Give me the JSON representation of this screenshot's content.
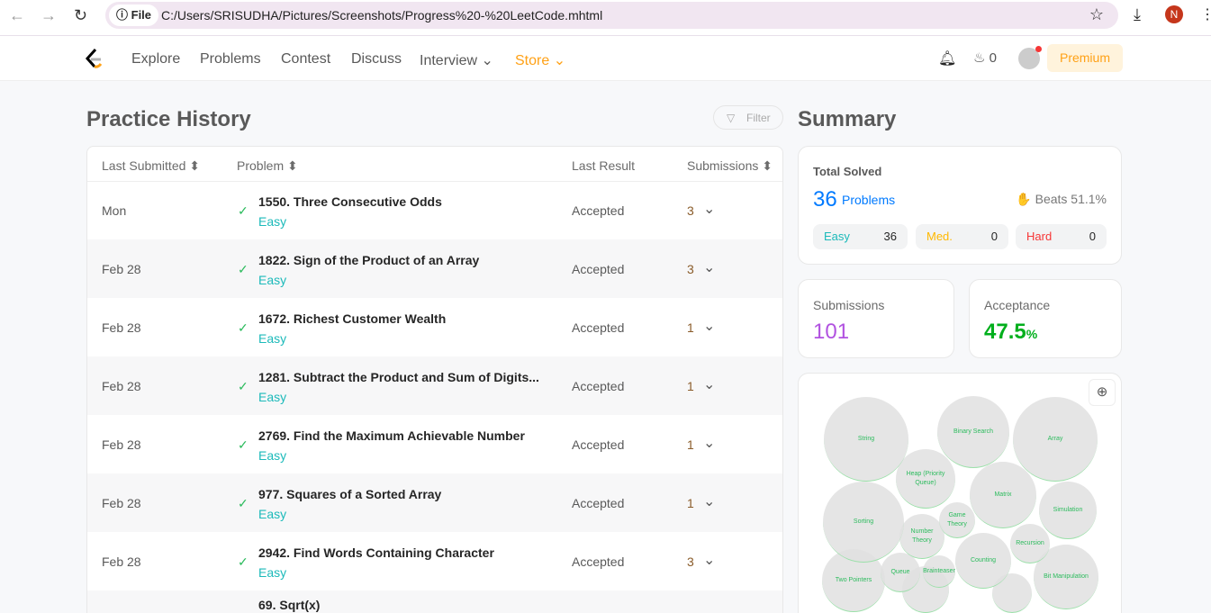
{
  "browser": {
    "file_label": "File",
    "url": "C:/Users/SRISUDHA/Pictures/Screenshots/Progress%20-%20LeetCode.mhtml",
    "avatar": "N"
  },
  "nav": {
    "items": [
      "Explore",
      "Problems",
      "Contest",
      "Discuss",
      "Interview"
    ],
    "store": "Store",
    "streak": "0",
    "premium": "Premium"
  },
  "history": {
    "title": "Practice History",
    "filter": "Filter",
    "columns": [
      "Last Submitted",
      "Problem",
      "Last Result",
      "Submissions"
    ],
    "rows": [
      {
        "date": "Mon",
        "title": "1550. Three Consecutive Odds",
        "difficulty": "Easy",
        "result": "Accepted",
        "subs": "3"
      },
      {
        "date": "Feb 28",
        "title": "1822. Sign of the Product of an Array",
        "difficulty": "Easy",
        "result": "Accepted",
        "subs": "3"
      },
      {
        "date": "Feb 28",
        "title": "1672. Richest Customer Wealth",
        "difficulty": "Easy",
        "result": "Accepted",
        "subs": "1"
      },
      {
        "date": "Feb 28",
        "title": "1281. Subtract the Product and Sum of Digits...",
        "difficulty": "Easy",
        "result": "Accepted",
        "subs": "1"
      },
      {
        "date": "Feb 28",
        "title": "2769. Find the Maximum Achievable Number",
        "difficulty": "Easy",
        "result": "Accepted",
        "subs": "1"
      },
      {
        "date": "Feb 28",
        "title": "977. Squares of a Sorted Array",
        "difficulty": "Easy",
        "result": "Accepted",
        "subs": "1"
      },
      {
        "date": "Feb 28",
        "title": "2942. Find Words Containing Character",
        "difficulty": "Easy",
        "result": "Accepted",
        "subs": "3"
      },
      {
        "date": "",
        "title": "69. Sqrt(x)",
        "difficulty": "",
        "result": "",
        "subs": ""
      }
    ]
  },
  "summary": {
    "title": "Summary",
    "total_label": "Total Solved",
    "total": "36",
    "problems_label": "Problems",
    "beats": "Beats 51.1%",
    "easy_label": "Easy",
    "easy": "36",
    "med_label": "Med.",
    "med": "0",
    "hard_label": "Hard",
    "hard": "0",
    "submissions_label": "Submissions",
    "submissions": "101",
    "acceptance_label": "Acceptance",
    "acceptance": "47.5",
    "pct": "%",
    "topics": [
      "String",
      "Binary Search",
      "Array",
      "Heap (Priority Queue)",
      "Matrix",
      "Simulation",
      "Sorting",
      "Game Theory",
      "Number Theory",
      "Recursion",
      "Counting",
      "Bit Manipulation",
      "Queue",
      "Brainteaser",
      "Two Pointers",
      "",
      ""
    ]
  }
}
